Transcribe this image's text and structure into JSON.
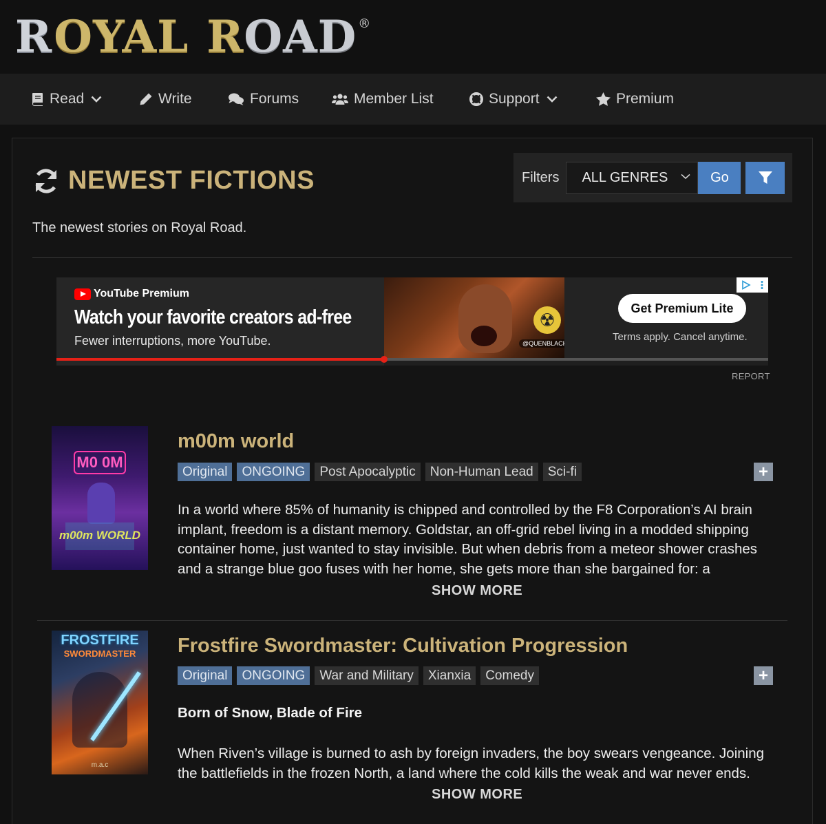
{
  "logo": {
    "word1_first": "R",
    "word1_rest": "OYAL",
    "word2_first": "R",
    "word2_rest": "OAD",
    "registered": "®"
  },
  "nav": [
    {
      "label": "Read",
      "icon": "book-icon",
      "dropdown": true
    },
    {
      "label": "Write",
      "icon": "pencil-icon",
      "dropdown": false
    },
    {
      "label": "Forums",
      "icon": "comments-icon",
      "dropdown": false
    },
    {
      "label": "Member List",
      "icon": "users-icon",
      "dropdown": false
    },
    {
      "label": "Support",
      "icon": "life-ring-icon",
      "dropdown": true
    },
    {
      "label": "Premium",
      "icon": "star-icon",
      "dropdown": false
    }
  ],
  "page": {
    "title": "NEWEST FICTIONS",
    "subtitle": "The newest stories on Royal Road."
  },
  "filters": {
    "label": "Filters",
    "genre_selected": "ALL GENRES",
    "go_label": "Go"
  },
  "ad": {
    "brand": "YouTube Premium",
    "headline": "Watch your favorite creators ad-free",
    "subline": "Fewer interruptions, more YouTube.",
    "handle": "@QUENBLACKWELL",
    "cta": "Get Premium Lite",
    "terms": "Terms apply. Cancel anytime.",
    "report": "REPORT",
    "progress": 0.46
  },
  "fictions": [
    {
      "title": "m00m world",
      "cover_text": "m00m WORLD",
      "tags": [
        {
          "label": "Original",
          "style": "blue"
        },
        {
          "label": "ONGOING",
          "style": "blue"
        },
        {
          "label": "Post Apocalyptic",
          "style": "gray"
        },
        {
          "label": "Non-Human Lead",
          "style": "gray"
        },
        {
          "label": "Sci-fi",
          "style": "gray"
        }
      ],
      "description_lines": [
        "In a world where 85% of humanity is chipped and controlled by the F8 Corporation’s AI brain",
        "implant, freedom is a distant memory. Goldstar, an off-grid rebel living in a modded shipping",
        "container home, just wanted to stay invisible. But when debris from a meteor shower crashes",
        "and a strange blue goo fuses with her home, she gets more than she bargained for: a"
      ],
      "show_more": "SHOW MORE"
    },
    {
      "title": "Frostfire Swordmaster: Cultivation Progression",
      "cover_text": "FROSTFIRE SWORDMASTER",
      "cover_author": "m.a.c",
      "tags": [
        {
          "label": "Original",
          "style": "blue"
        },
        {
          "label": "ONGOING",
          "style": "blue"
        },
        {
          "label": "War and Military",
          "style": "gray"
        },
        {
          "label": "Xianxia",
          "style": "gray"
        },
        {
          "label": "Comedy",
          "style": "gray"
        }
      ],
      "tagline": "Born of Snow, Blade of Fire",
      "description_lines": [
        "When Riven’s village is burned to ash by foreign invaders, the boy swears vengeance. Joining",
        "the battlefields in the frozen North, a land where the cold kills the weak and war never ends."
      ],
      "show_more": "SHOW MORE"
    }
  ]
}
